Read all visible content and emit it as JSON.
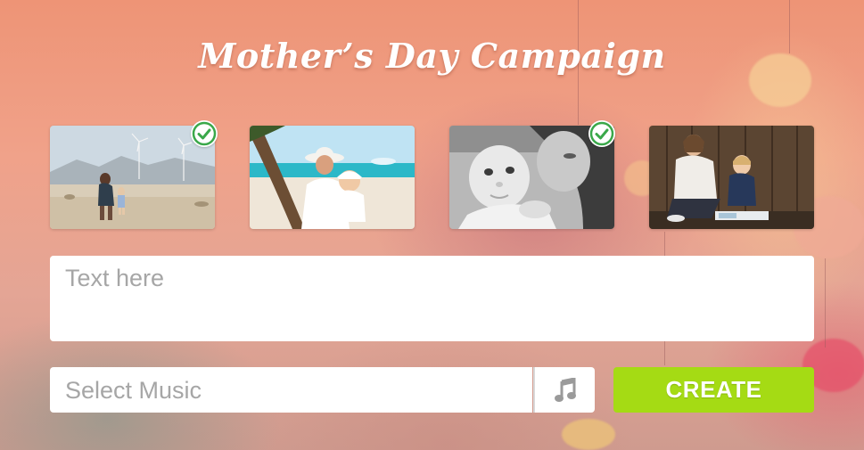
{
  "page": {
    "title": "Mother’s Day Campaign"
  },
  "photos": [
    {
      "name": "photo-mother-child-desert-windmills",
      "selected": true
    },
    {
      "name": "photo-mother-baby-beach-palm",
      "selected": false
    },
    {
      "name": "photo-mother-baby-black-white",
      "selected": true
    },
    {
      "name": "photo-mother-son-wooden-wall",
      "selected": false
    }
  ],
  "message": {
    "placeholder": "Text here"
  },
  "music": {
    "placeholder": "Select Music",
    "icon": "music-note-icon"
  },
  "create_button": {
    "label": "CREATE"
  },
  "colors": {
    "accent": "#a5db14",
    "check": "#3aa84a",
    "background": "#ee9476"
  }
}
